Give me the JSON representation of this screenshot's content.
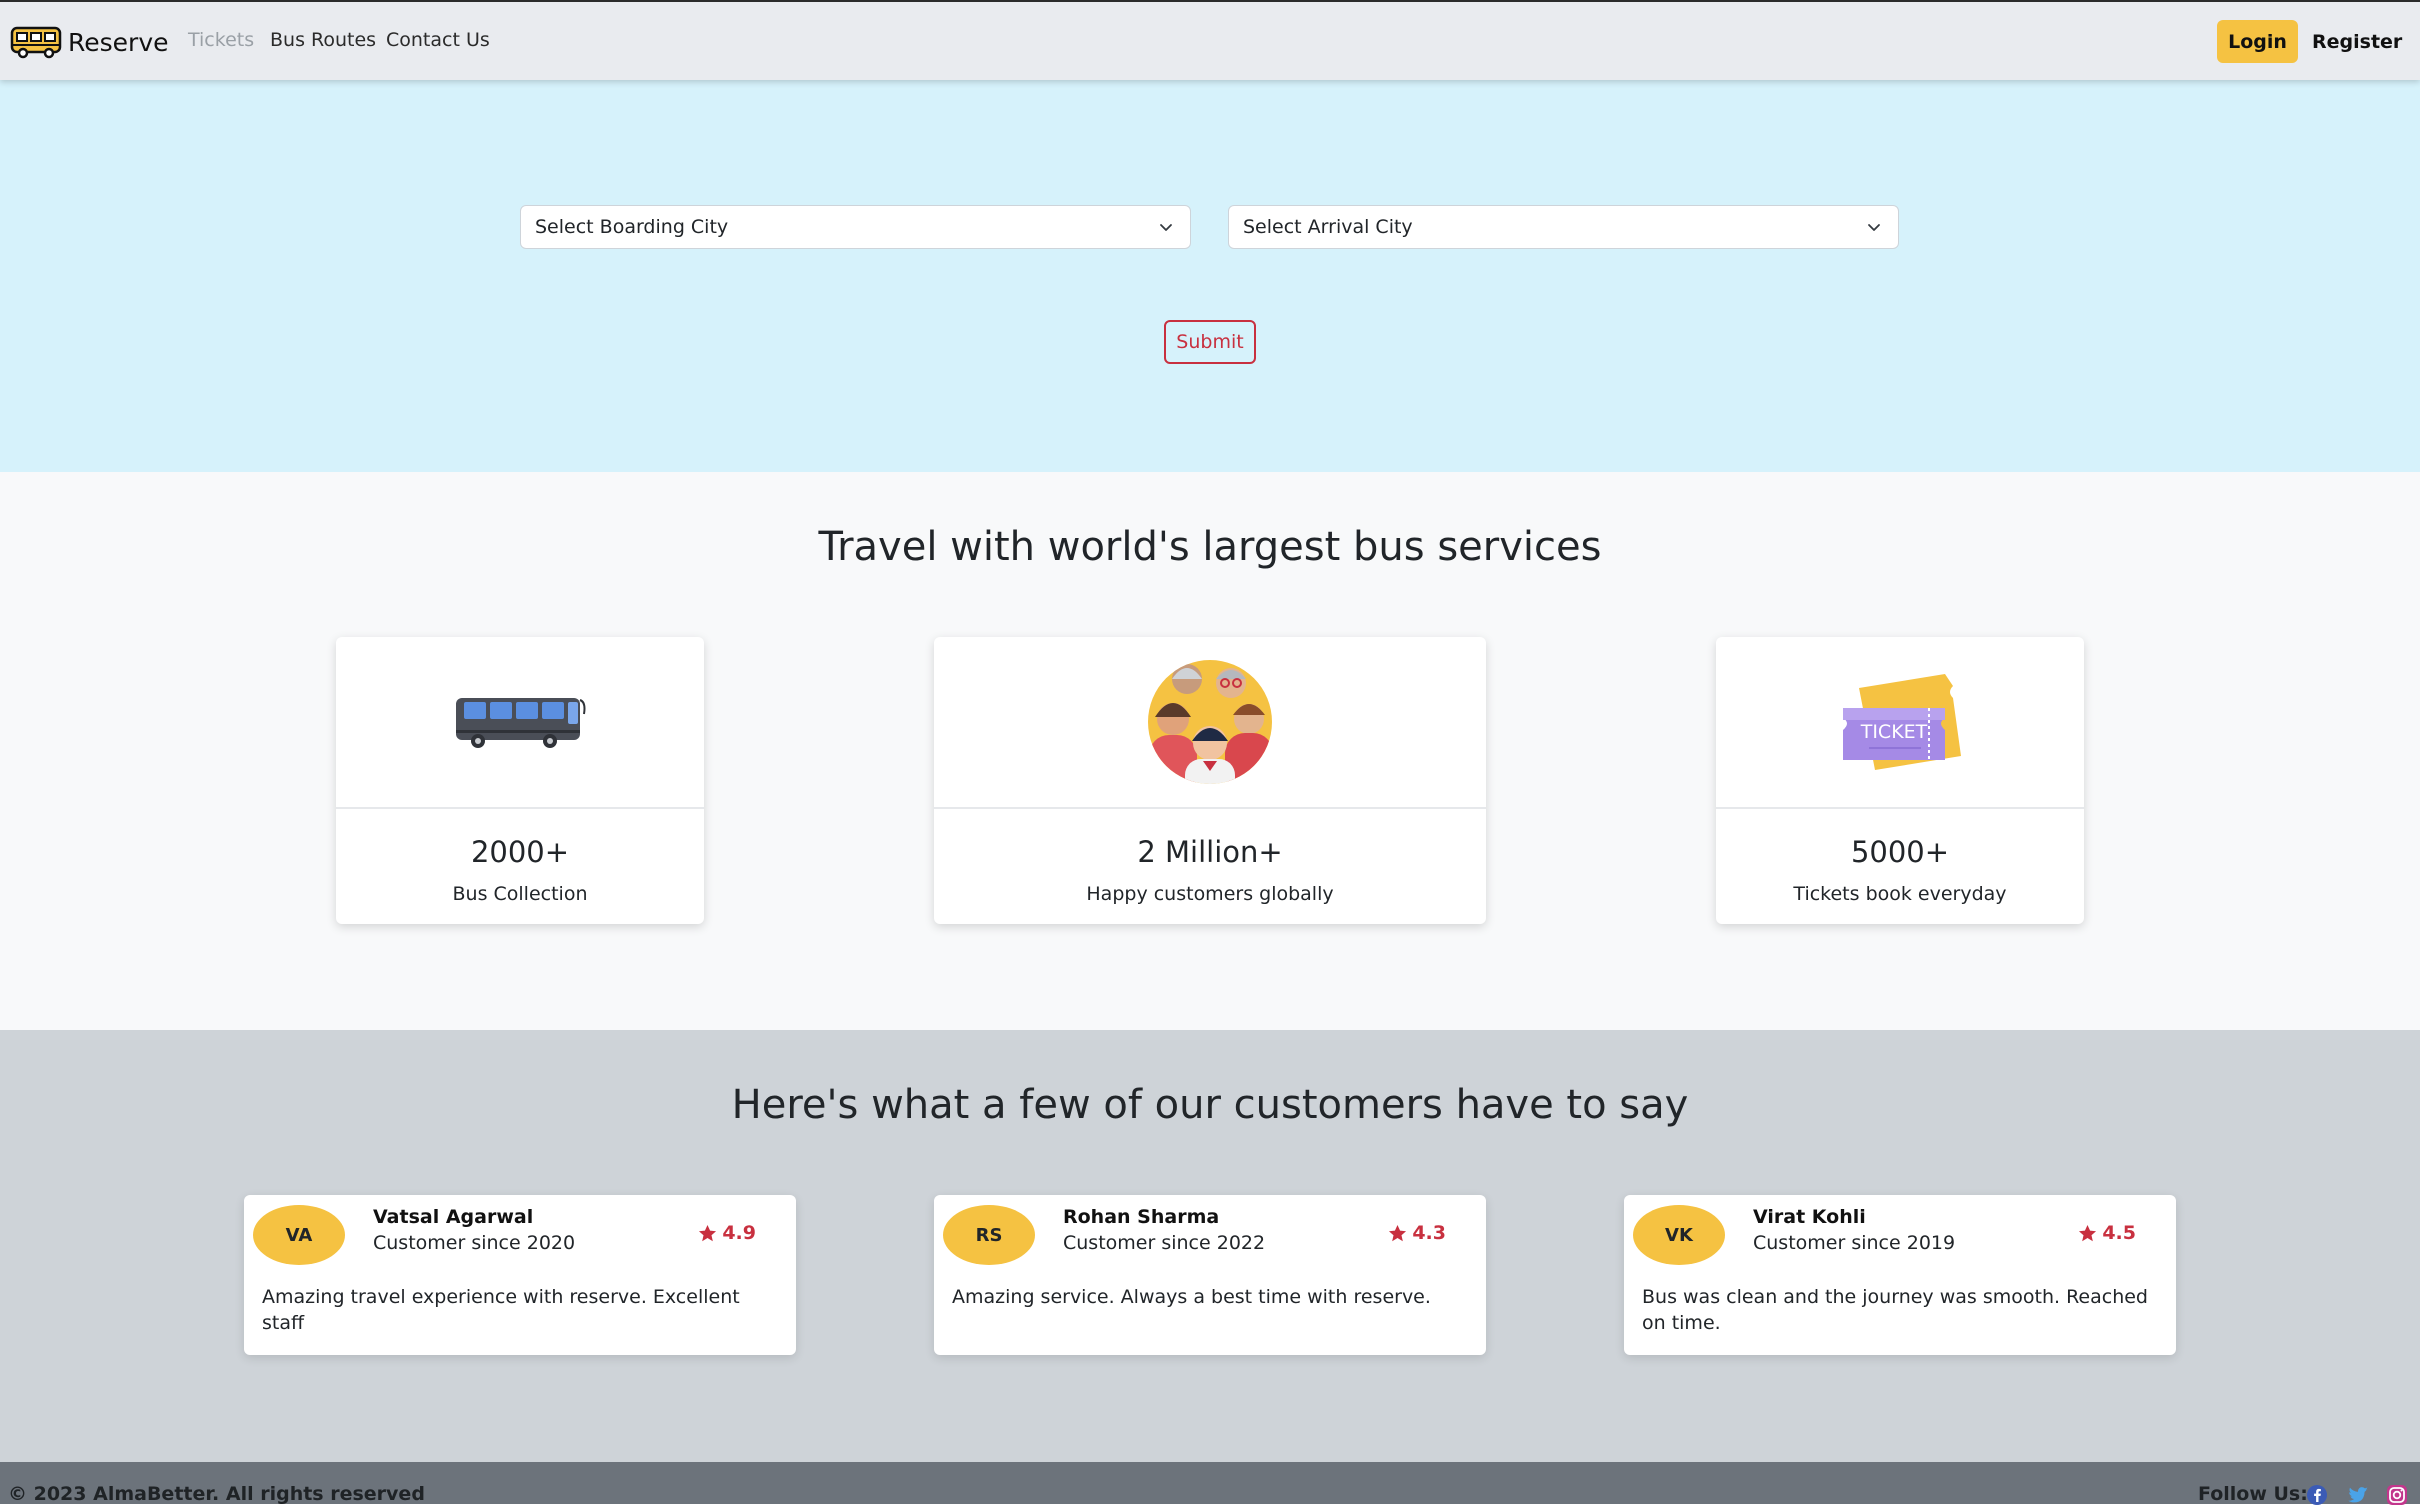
{
  "navbar": {
    "brand": "Reserve",
    "brand_icon": "bus-icon",
    "links": [
      "Tickets",
      "Bus Routes",
      "Contact Us"
    ],
    "login_label": "Login",
    "register_label": "Register"
  },
  "search": {
    "boarding_placeholder": "Select Boarding City",
    "arrival_placeholder": "Select Arrival City",
    "submit_label": "Submit"
  },
  "stats": {
    "title": "Travel with world's largest bus services",
    "cards": [
      {
        "icon": "bus-icon",
        "value": "2000+",
        "label": "Bus Collection"
      },
      {
        "icon": "people-icon",
        "value": "2 Million+",
        "label": "Happy customers globally"
      },
      {
        "icon": "ticket-icon",
        "value": "5000+",
        "label": "Tickets book everyday"
      }
    ]
  },
  "testimonials": {
    "title": "Here's what a few of our customers have to say",
    "items": [
      {
        "initials": "VA",
        "name": "Vatsal Agarwal",
        "since": "Customer since 2020",
        "rating": "4.9",
        "text": "Amazing travel experience with reserve. Excellent staff"
      },
      {
        "initials": "RS",
        "name": "Rohan Sharma",
        "since": "Customer since 2022",
        "rating": "4.3",
        "text": "Amazing service. Always a best time with reserve."
      },
      {
        "initials": "VK",
        "name": "Virat Kohli",
        "since": "Customer since 2019",
        "rating": "4.5",
        "text": "Bus was clean and the journey was smooth. Reached on time."
      }
    ]
  },
  "footer": {
    "copyright": "© 2023 AlmaBetter. All rights reserved",
    "follow_label": "Follow Us:",
    "social_icons": [
      "facebook-icon",
      "twitter-icon",
      "instagram-icon"
    ]
  },
  "colors": {
    "accent": "#f5c242",
    "danger": "#c8303f",
    "hero_bg": "#d6f2fb",
    "testimonial_bg": "#ced3d8",
    "footer_bg": "#6c737b"
  }
}
